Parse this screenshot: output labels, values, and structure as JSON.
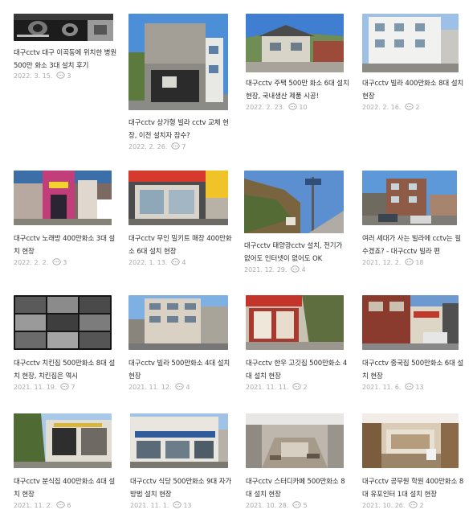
{
  "posts": [
    {
      "title": "대구cctv 대구 이곡동에 위치한 병원 500만 화소 3대 설치 후기",
      "date": "2022. 3. 15.",
      "comments": "3",
      "thumb": "cctv-camera-dark"
    },
    {
      "title": "대구cctv 상가형 빌라 cctv 교체 현장, 이전 설치자 잠수?",
      "date": "2022. 2. 26.",
      "comments": "7",
      "thumb": "building-exterior"
    },
    {
      "title": "대구cctv 주택 500만 화소 6대 설치 현장, 국내생산 제품 시공!",
      "date": "2022. 2. 23.",
      "comments": "10",
      "thumb": "house-exterior"
    },
    {
      "title": "대구cctv 빌라 400만화소 8대 설치 현장",
      "date": "2022. 2. 16.",
      "comments": "2",
      "thumb": "villa-exterior"
    },
    {
      "title": "대구cctv 노래방 400만화소 3대 설치 현장",
      "date": "2022. 2. 2.",
      "comments": "3",
      "thumb": "karaoke-exterior"
    },
    {
      "title": "대구cctv 무인 밀키트 매장 400만화소 6대 설치 현장",
      "date": "2022. 1. 13.",
      "comments": "4",
      "thumb": "store-exterior"
    },
    {
      "title": "대구cctv 태양광cctv 설치, 전기가 없어도 인터넷이 없어도 OK",
      "date": "2021. 12. 29.",
      "comments": "4",
      "thumb": "solar-pole"
    },
    {
      "title": "여러 세대가 사는 빌라에 cctv는 필수겠죠? - 대구cctv 빌라 편",
      "date": "2021. 12. 2.",
      "comments": "18",
      "thumb": "villa-street"
    },
    {
      "title": "대구cctv 치킨집 500만화소 8대 설치 현장, 치킨집은 역시",
      "date": "2021. 11. 19.",
      "comments": "7",
      "thumb": "cctv-monitor"
    },
    {
      "title": "대구cctv 빌라 500만화소 4대 설치 현장",
      "date": "2021. 11. 12.",
      "comments": "4",
      "thumb": "villa-tall"
    },
    {
      "title": "대구cctv 한우 고깃집 500만화소 4대 설치 현장",
      "date": "2021. 11. 11.",
      "comments": "2",
      "thumb": "restaurant-exterior"
    },
    {
      "title": "대구cctv 중국집 500만화소 6대 설치 현장",
      "date": "2021. 11. 6.",
      "comments": "13",
      "thumb": "chinese-restaurant"
    },
    {
      "title": "대구cctv 분식집 400만화소 4대 설치 현장",
      "date": "2021. 11. 2.",
      "comments": "6",
      "thumb": "snack-shop"
    },
    {
      "title": "대구cctv 식당 500만화소 9대 자가방범 설치 현장",
      "date": "2021. 11. 1.",
      "comments": "13",
      "thumb": "restaurant-front"
    },
    {
      "title": "대구cctv 스터디카페 500만화소 8대 설치 현장",
      "date": "2021. 10. 28.",
      "comments": "5",
      "thumb": "interior-construction"
    },
    {
      "title": "대구cctv 공무원 학원 400만화소 8대 유포인터 1대 설치 현장",
      "date": "2021. 10. 26.",
      "comments": "2",
      "thumb": "academy-interior"
    }
  ]
}
